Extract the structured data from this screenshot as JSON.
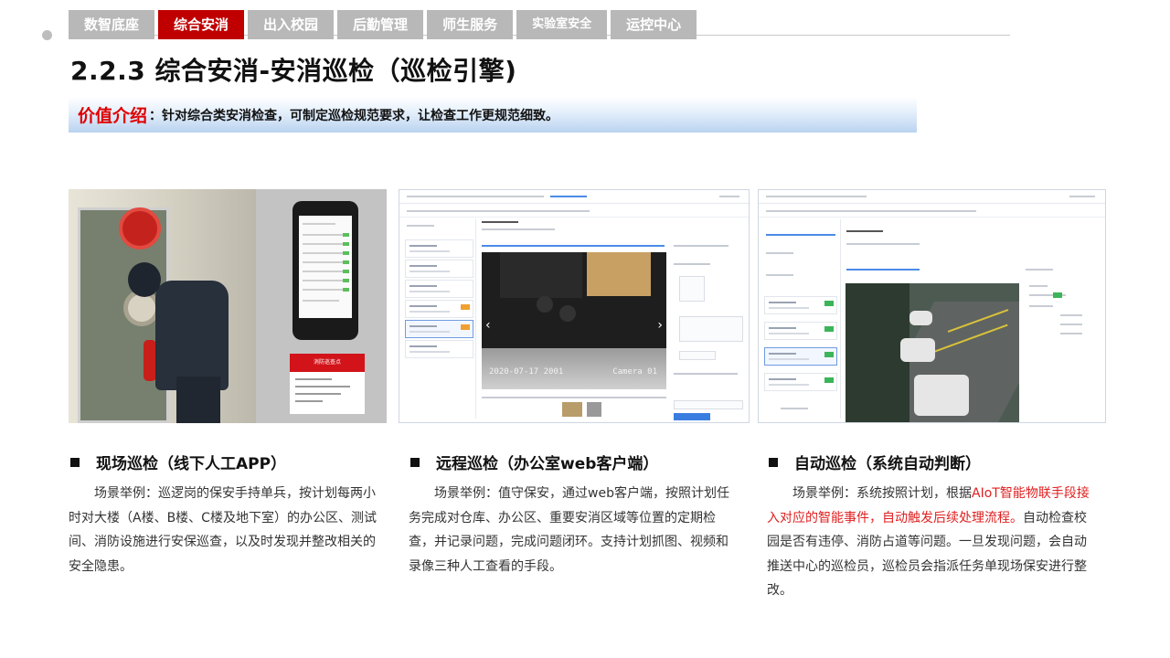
{
  "nav": {
    "tabs": [
      {
        "label": "数智底座",
        "active": false
      },
      {
        "label": "综合安消",
        "active": true
      },
      {
        "label": "出入校园",
        "active": false
      },
      {
        "label": "后勤管理",
        "active": false
      },
      {
        "label": "师生服务",
        "active": false
      },
      {
        "label": "实验室安全",
        "active": false
      },
      {
        "label": "运控中心",
        "active": false
      }
    ]
  },
  "title": "2.2.3 综合安消-安消巡检（巡检引擎)",
  "value": {
    "label": "价值介绍",
    "text": "：针对综合类安消检查，可制定巡检规范要求，让检查工作更规范细致。"
  },
  "panel1": {
    "card_title": "消防巡查点"
  },
  "panel2": {
    "timestamp": "2020-07-17  2001",
    "camera": "Camera 01"
  },
  "columns": [
    {
      "title": "现场巡检（线下人工APP）",
      "text": "场景举例：巡逻岗的保安手持单兵，按计划每两小时对大楼（A楼、B楼、C楼及地下室）的办公区、测试间、消防设施进行安保巡查，以及时发现并整改相关的安全隐患。"
    },
    {
      "title": "远程巡检（办公室web客户端）",
      "text": "场景举例：值守保安，通过web客户端，按照计划任务完成对仓库、办公区、重要安消区域等位置的定期检查，并记录问题，完成问题闭环。支持计划抓图、视频和录像三种人工查看的手段。"
    },
    {
      "title": "自动巡检（系统自动判断）",
      "text_before": "场景举例：系统按照计划，根据",
      "text_highlight": "AIoT智能物联手段接入对应的智能事件，自动触发后续处理流程。",
      "text_after": "自动检查校园是否有违停、消防占道等问题。一旦发现问题，会自动推送中心的巡检员，巡检员会指派任务单现场保安进行整改。"
    }
  ]
}
